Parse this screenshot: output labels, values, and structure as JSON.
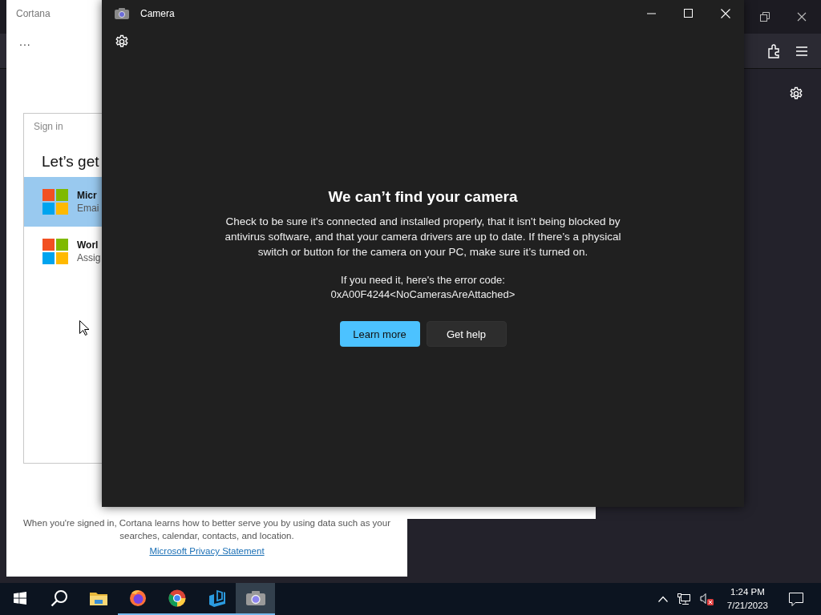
{
  "cortana": {
    "title": "Cortana",
    "more": "...",
    "sign_in_dialog": {
      "title": "Sign in",
      "heading": "Let’s get",
      "accounts": [
        {
          "name": "Micr",
          "detail": "Emai",
          "selected": true
        },
        {
          "name": "Worl",
          "detail": "Assig",
          "selected": false
        }
      ]
    },
    "footer": "When you're signed in, Cortana learns how to better serve you by using data such as your searches, calendar, contacts, and location.",
    "privacy_link": "Microsoft Privacy Statement"
  },
  "camera_window": {
    "title": "Camera",
    "error": {
      "heading": "We can’t find your camera",
      "body": "Check to be sure it's connected and installed properly, that it isn't being blocked by antivirus software, and that your camera drivers are up to date. If there’s a physical switch or button for the camera on your PC, make sure it’s turned on.",
      "code_label": "If you need it, here's the error code:",
      "code": "0xA00F4244<NoCamerasAreAttached>"
    },
    "buttons": [
      {
        "label": "Learn more",
        "kind": "primary"
      },
      {
        "label": "Get help",
        "kind": "secondary"
      }
    ]
  },
  "taskbar": {
    "apps": [
      {
        "kind": "start",
        "running": false,
        "selected": false
      },
      {
        "kind": "search",
        "running": false,
        "selected": false
      },
      {
        "kind": "explorer",
        "running": false,
        "selected": false
      },
      {
        "kind": "firefox",
        "running": true,
        "selected": false
      },
      {
        "kind": "chrome",
        "running": true,
        "selected": false
      },
      {
        "kind": "editor",
        "running": true,
        "selected": false
      },
      {
        "kind": "camera",
        "running": true,
        "selected": true
      }
    ],
    "clock": {
      "time": "1:24 PM",
      "date": "7/21/2023"
    }
  }
}
